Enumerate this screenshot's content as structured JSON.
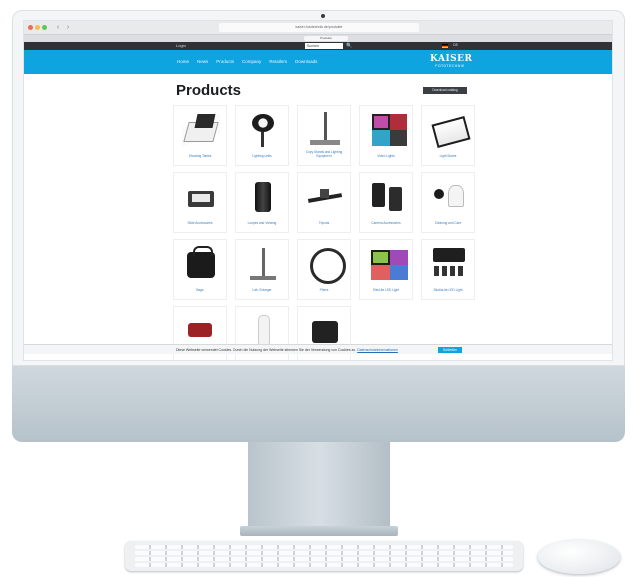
{
  "browser": {
    "url": "kaiser-fototechnik.de/produkte",
    "tab_label": "Produkte",
    "back_glyph": "‹",
    "forward_glyph": "›"
  },
  "topbar": {
    "login_label": "Login",
    "search_placeholder": "Suchen",
    "search_icon": "🔍",
    "language_label": "DE"
  },
  "nav": {
    "items": [
      "Home",
      "News",
      "Products",
      "Company",
      "Retailers",
      "Downloads"
    ]
  },
  "logo": {
    "main": "KAISER",
    "sub": "FOTOTECHNIK"
  },
  "page": {
    "title": "Products",
    "download_button": "Download catalog"
  },
  "products": [
    {
      "label": "Shooting Tables",
      "icon": "table"
    },
    {
      "label": "Lighting Units",
      "icon": "light"
    },
    {
      "label": "Copy Stands and Lighting Equipment",
      "icon": "copy"
    },
    {
      "label": "Video Lights",
      "icon": "panels"
    },
    {
      "label": "Light Boxes",
      "icon": "lightbox"
    },
    {
      "label": "Slide Accessories",
      "icon": "viewer"
    },
    {
      "label": "Loupes and Viewing",
      "icon": "loupe"
    },
    {
      "label": "Tripods",
      "icon": "rail"
    },
    {
      "label": "Camera Accessories",
      "icon": "camera-acc"
    },
    {
      "label": "Cleaning and Care",
      "icon": "cleaning"
    },
    {
      "label": "Bags",
      "icon": "bag"
    },
    {
      "label": "Lab. Enlarger",
      "icon": "stand"
    },
    {
      "label": "Filters",
      "icon": "filter"
    },
    {
      "label": "SlimLite LED Light",
      "icon": "slim"
    },
    {
      "label": "StudioLite LED Light",
      "icon": "kit"
    },
    {
      "label": "",
      "icon": "partial1"
    },
    {
      "label": "",
      "icon": "partial2"
    },
    {
      "label": "",
      "icon": "partial3"
    }
  ],
  "cookie": {
    "text": "Diese Webseite verwendet Cookies. Durch die Nutzung der Webseite stimmen Sie der Verwendung von Cookies zu.",
    "link": "Datenschutzinformationen",
    "button": "Schließen"
  },
  "colors": {
    "nav_blue": "#0ea4e0",
    "topbar_dark": "#2f3236",
    "link_blue": "#3b7bbf"
  }
}
